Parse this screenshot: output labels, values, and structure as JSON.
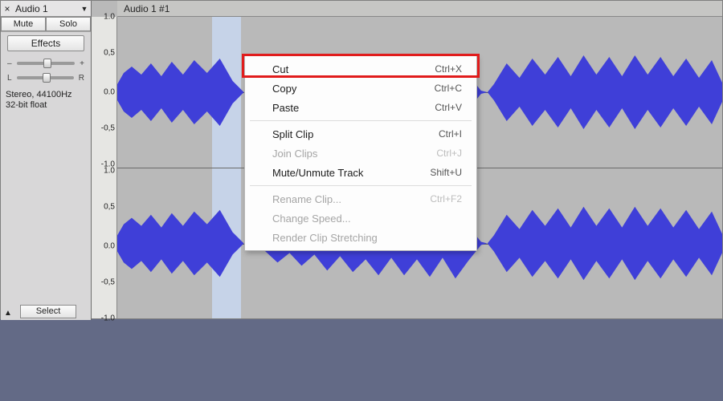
{
  "track": {
    "name": "Audio 1",
    "close": "×",
    "dropdown": "▼",
    "mute": "Mute",
    "solo": "Solo",
    "effects": "Effects",
    "gain": {
      "left": "–",
      "right": "+"
    },
    "pan": {
      "left": "L",
      "right": "R"
    },
    "meta_line1": "Stereo, 44100Hz",
    "meta_line2": "32-bit float",
    "collapse": "▲",
    "select": "Select"
  },
  "ruler": {
    "ch1": [
      "1.0",
      "0,5",
      "0.0",
      "-0,5",
      "-1.0"
    ],
    "ch2": [
      "1.0",
      "0,5",
      "0.0",
      "-0,5",
      "-1.0"
    ]
  },
  "clip": {
    "title": "Audio 1 #1"
  },
  "context_menu": {
    "cut": {
      "label": "Cut",
      "shortcut": "Ctrl+X"
    },
    "copy": {
      "label": "Copy",
      "shortcut": "Ctrl+C"
    },
    "paste": {
      "label": "Paste",
      "shortcut": "Ctrl+V"
    },
    "split": {
      "label": "Split Clip",
      "shortcut": "Ctrl+I"
    },
    "join": {
      "label": "Join Clips",
      "shortcut": "Ctrl+J"
    },
    "mute": {
      "label": "Mute/Unmute Track",
      "shortcut": "Shift+U"
    },
    "rename": {
      "label": "Rename Clip...",
      "shortcut": "Ctrl+F2"
    },
    "speed": {
      "label": "Change Speed...",
      "shortcut": ""
    },
    "render": {
      "label": "Render Clip Stretching",
      "shortcut": ""
    }
  },
  "colors": {
    "waveform": "#3f3fd8",
    "waveform_dark": "#232399",
    "selection": "#cbd8ef",
    "highlight": "#e11c1c"
  }
}
